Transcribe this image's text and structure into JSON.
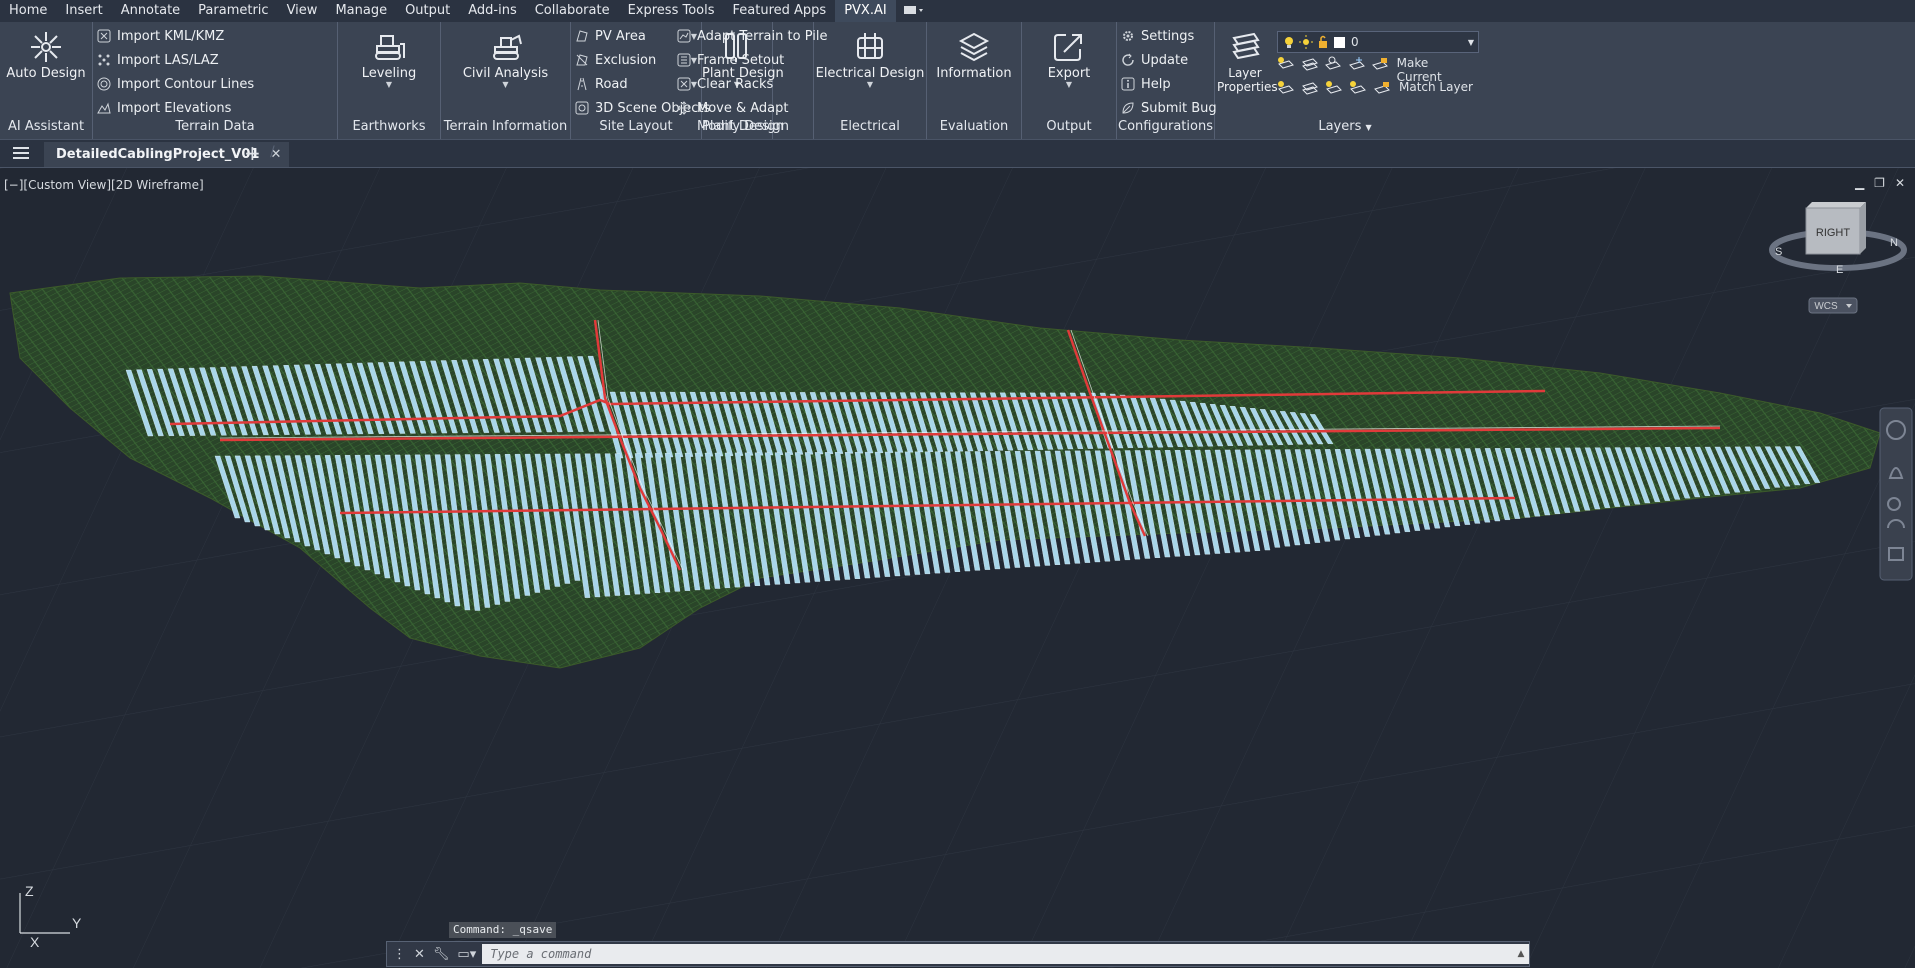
{
  "menu": {
    "items": [
      "Home",
      "Insert",
      "Annotate",
      "Parametric",
      "View",
      "Manage",
      "Output",
      "Add-ins",
      "Collaborate",
      "Express Tools",
      "Featured Apps",
      "PVX.AI"
    ],
    "active": "PVX.AI"
  },
  "ribbon": {
    "ai_assistant": {
      "title": "AI Assistant",
      "button": "Auto Design"
    },
    "terrain_data": {
      "title": "Terrain Data",
      "items": [
        "Import KML/KMZ",
        "Import LAS/LAZ",
        "Import Contour Lines",
        "Import Elevations"
      ]
    },
    "earthworks": {
      "title": "Earthworks",
      "button": "Leveling"
    },
    "terrain_information": {
      "title": "Terrain Information",
      "button": "Civil Analysis"
    },
    "site_layout": {
      "title": "Site Layout",
      "items": [
        "PV Area",
        "Exclusion",
        "Road",
        "3D Scene Objects"
      ]
    },
    "plant_design": {
      "title": "Plant Design",
      "button": "Plant Design"
    },
    "modify_design": {
      "title": "Modify Design",
      "items": [
        "Adapt Terrain to Pile",
        "Frame Setout",
        "Clear Racks",
        "Move & Adapt"
      ]
    },
    "electrical": {
      "title": "Electrical",
      "button": "Electrical Design"
    },
    "evaluation": {
      "title": "Evaluation",
      "button": "Information"
    },
    "output": {
      "title": "Output",
      "button": "Export"
    },
    "configurations": {
      "title": "Configurations",
      "items": [
        "Settings",
        "Update",
        "Help",
        "Submit Bug"
      ]
    },
    "layers": {
      "title": "Layers",
      "button": "Layer Properties",
      "layer_value": "0",
      "make_current": "Make Current",
      "match_layer": "Match Layer"
    }
  },
  "tabs": {
    "document": "DetailedCablingProject_V01"
  },
  "viewport": {
    "label": "[−][Custom View][2D Wireframe]",
    "viewcube_face": "RIGHT",
    "compass": {
      "n": "N",
      "s": "S",
      "e": "E"
    },
    "wcs": "WCS",
    "ucs": {
      "x": "X",
      "y": "Y",
      "z": "Z"
    }
  },
  "command": {
    "history": "Command: _qsave",
    "placeholder": "Type a command"
  },
  "colors": {
    "panel": "#a9d6ea",
    "cable": "#e03a3a",
    "terrain": "#2f4e2c",
    "background": "#222833"
  }
}
